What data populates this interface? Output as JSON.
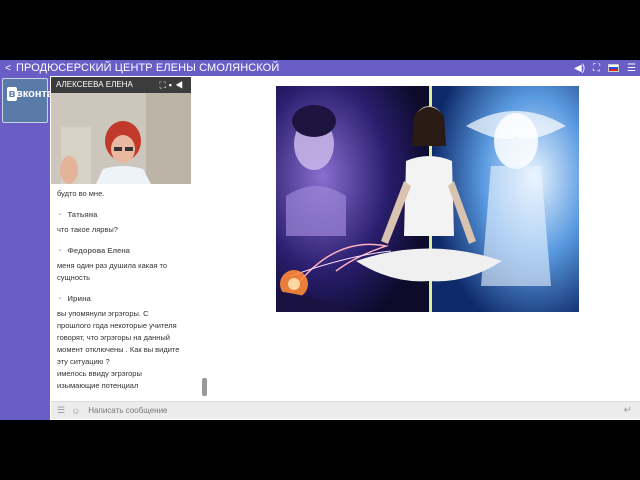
{
  "topbar": {
    "title": "ПРОДЮСЕРСКИЙ ЦЕНТР ЕЛЕНЫ СМОЛЯНСКОЙ"
  },
  "sidebar": {
    "vk_logo": "вконтакте"
  },
  "video": {
    "name": "АЛЕКСЕЕВА ЕЛЕНА"
  },
  "chat": {
    "partial": [
      "будто во мне."
    ],
    "messages": [
      {
        "author": "Татьяна",
        "lines": [
          "что такое лярвы?"
        ]
      },
      {
        "author": "Федорова Елена",
        "lines": [
          "меня один раз душила какая то",
          "сущность"
        ]
      },
      {
        "author": "Ирина",
        "lines": [
          "вы упомянули эгрэгоры. С",
          "прошлого года некоторые учителя",
          "говорят, что эгрэгоры на данный",
          "момент отключены . Как вы видите",
          "эту ситуацию ?",
          "имелось ввиду эгрэгоры",
          "изымающие потенциал"
        ]
      }
    ]
  },
  "input": {
    "placeholder": "Написать сообщение"
  },
  "colors": {
    "accent": "#6a5ec6"
  }
}
